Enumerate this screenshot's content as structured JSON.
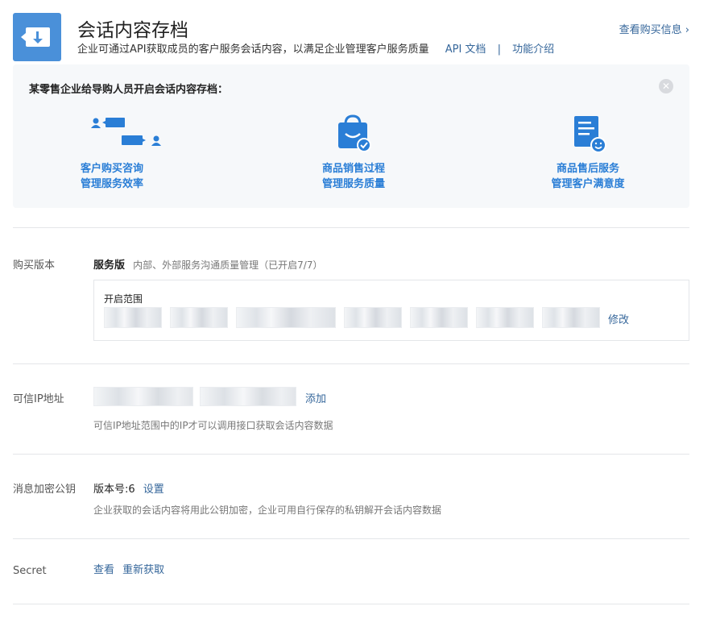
{
  "header": {
    "title": "会话内容存档",
    "description": "企业可通过API获取成员的客户服务会话内容，以满足企业管理客户服务质量",
    "api_docs_link": "API 文档",
    "separator": "|",
    "features_link": "功能介绍",
    "buy_info_link": "查看购买信息 ›"
  },
  "promo": {
    "title": "某零售企业给导购人员开启会话内容存档：",
    "close_icon": "✕",
    "features": [
      {
        "icon": "chat-users-icon",
        "line1": "客户购买咨询",
        "line2": "管理服务效率"
      },
      {
        "icon": "shopping-bag-icon",
        "line1": "商品销售过程",
        "line2": "管理服务质量"
      },
      {
        "icon": "document-smile-icon",
        "line1": "商品售后服务",
        "line2": "管理客户满意度"
      }
    ]
  },
  "purchase": {
    "label": "购买版本",
    "plan_name": "服务版",
    "plan_note": "内部、外部服务沟通质量管理（已开启7/7）",
    "scope_title": "开启范围",
    "edit_link": "修改"
  },
  "trusted_ip": {
    "label": "可信IP地址",
    "add_link": "添加",
    "hint": "可信IP地址范围中的IP才可以调用接口获取会话内容数据"
  },
  "encryption": {
    "label": "消息加密公钥",
    "version_text": "版本号:6",
    "settings_link": "设置",
    "hint": "企业获取的会话内容将用此公钥加密，企业可用自行保存的私钥解开会话内容数据"
  },
  "secret": {
    "label": "Secret",
    "view_link": "查看",
    "refetch_link": "重新获取"
  },
  "colors": {
    "accent": "#4a90d9",
    "link": "#36679b",
    "feature_blue": "#2a7ed6"
  }
}
